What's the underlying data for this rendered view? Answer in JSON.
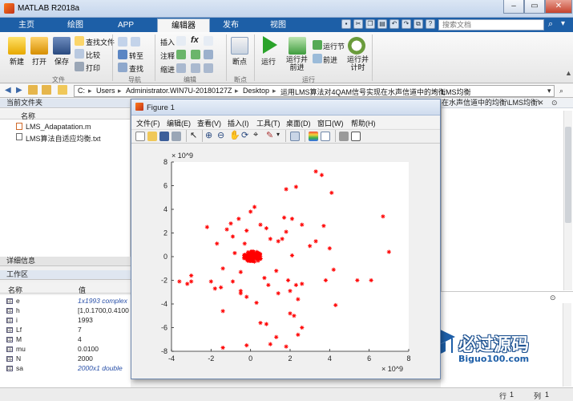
{
  "window": {
    "title": "MATLAB R2018a"
  },
  "ribbon_tabs": [
    "主页",
    "绘图",
    "APP",
    "编辑器",
    "发布",
    "视图"
  ],
  "help_search_placeholder": "搜索文档",
  "ribbon": {
    "file_group": {
      "new": "新建",
      "open": "打开",
      "save": "保存",
      "find_files": "查找文件",
      "compare": "比较",
      "print": "打印",
      "label": "文件"
    },
    "nav_group": {
      "goto": "转至",
      "find": "查找",
      "label": "导航"
    },
    "edit_group": {
      "insert": "插入",
      "comment": "注释",
      "indent": "缩进",
      "label": "编辑"
    },
    "breakpoint_group": {
      "breakpoints": "断点",
      "label": "断点"
    },
    "run_group": {
      "run": "运行",
      "run_advance": "运行并\n前进",
      "run_section": "运行节",
      "advance": "前进",
      "run_time": "运行并\n计时",
      "label": "运行"
    }
  },
  "address": {
    "crumbs": [
      "C:",
      "Users",
      "Administrator.WIN7U-20180127Z",
      "Desktop",
      "运用LMS算法对4QAM信号实现在水声信道中的均衡",
      "LMS均衡"
    ],
    "right_tail": "在水声信道中的均衡\\LMS均衡\\"
  },
  "file_browser": {
    "title": "当前文件夹",
    "column": "名称",
    "files": [
      "LMS_Adapatation.m",
      "LMS算法自适应均衡.txt"
    ]
  },
  "details_title": "详细信息",
  "workspace": {
    "title": "工作区",
    "col_name": "名称",
    "col_value": "值",
    "rows": [
      {
        "name": "e",
        "value": "1x1993 complex"
      },
      {
        "name": "h",
        "value": "[1,0.1700,0.4100"
      },
      {
        "name": "i",
        "value": "1993"
      },
      {
        "name": "Lf",
        "value": "7"
      },
      {
        "name": "M",
        "value": "4"
      },
      {
        "name": "mu",
        "value": "0.0100"
      },
      {
        "name": "N",
        "value": "2000"
      },
      {
        "name": "sa",
        "value": "2000x1 double"
      }
    ]
  },
  "figure": {
    "title": "Figure 1",
    "menus": [
      "文件(F)",
      "编辑(E)",
      "查看(V)",
      "插入(I)",
      "工具(T)",
      "桌面(D)",
      "窗口(W)",
      "帮助(H)"
    ]
  },
  "chart_data": {
    "type": "scatter",
    "title": "",
    "xlabel": "",
    "ylabel": "",
    "x_exponent": "× 10^9",
    "y_exponent": "× 10^9",
    "xlim": [
      -4,
      8
    ],
    "ylim": [
      -8,
      8
    ],
    "xticks": [
      -4,
      -2,
      0,
      2,
      4,
      6,
      8
    ],
    "yticks": [
      -8,
      -6,
      -4,
      -2,
      0,
      2,
      4,
      6,
      8
    ],
    "marker": "*",
    "color": "#ff0000",
    "series": [
      {
        "points": [
          [
            3.3,
            7.2
          ],
          [
            2.3,
            5.9
          ],
          [
            1.8,
            5.7
          ],
          [
            4.1,
            5.4
          ],
          [
            3.6,
            6.9
          ],
          [
            0.2,
            4.2
          ],
          [
            0.0,
            3.8
          ],
          [
            -0.6,
            3.2
          ],
          [
            -1.0,
            2.8
          ],
          [
            0.5,
            2.7
          ],
          [
            1.7,
            3.3
          ],
          [
            2.1,
            3.2
          ],
          [
            6.7,
            3.4
          ],
          [
            -2.2,
            2.5
          ],
          [
            -1.2,
            2.3
          ],
          [
            -0.2,
            2.2
          ],
          [
            0.8,
            2.4
          ],
          [
            1.8,
            2.1
          ],
          [
            2.6,
            2.7
          ],
          [
            3.7,
            2.6
          ],
          [
            -0.9,
            1.7
          ],
          [
            1.0,
            1.5
          ],
          [
            1.4,
            1.3
          ],
          [
            3.3,
            1.3
          ],
          [
            -1.7,
            1.1
          ],
          [
            -0.3,
            1.1
          ],
          [
            1.6,
            1.5
          ],
          [
            3.0,
            0.9
          ],
          [
            4.0,
            0.7
          ],
          [
            -0.8,
            0.3
          ],
          [
            7.0,
            0.4
          ],
          [
            2.1,
            0.1
          ],
          [
            4.2,
            -1.1
          ],
          [
            3.8,
            -2.0
          ],
          [
            -1.4,
            -1.0
          ],
          [
            -0.5,
            -1.3
          ],
          [
            1.3,
            -1.2
          ],
          [
            -3.0,
            -1.6
          ],
          [
            -3.6,
            -2.1
          ],
          [
            -3.0,
            -2.1
          ],
          [
            -3.2,
            -2.3
          ],
          [
            -2.0,
            -2.1
          ],
          [
            -0.9,
            -2.1
          ],
          [
            0.7,
            -1.8
          ],
          [
            1.9,
            -2.0
          ],
          [
            2.3,
            -2.4
          ],
          [
            2.0,
            -2.9
          ],
          [
            -1.5,
            -2.6
          ],
          [
            -0.5,
            -2.9
          ],
          [
            0.9,
            -2.4
          ],
          [
            2.6,
            -2.3
          ],
          [
            5.4,
            -2.0
          ],
          [
            6.1,
            -2.0
          ],
          [
            -0.2,
            -3.4
          ],
          [
            1.4,
            -3.1
          ],
          [
            2.4,
            -3.6
          ],
          [
            0.3,
            -3.9
          ],
          [
            4.3,
            -4.1
          ],
          [
            -1.4,
            -4.6
          ],
          [
            2.0,
            -4.8
          ],
          [
            2.2,
            -5.0
          ],
          [
            0.5,
            -5.6
          ],
          [
            0.8,
            -5.7
          ],
          [
            2.6,
            -6.0
          ],
          [
            2.4,
            -6.6
          ],
          [
            1.3,
            -6.8
          ],
          [
            -0.2,
            -7.5
          ],
          [
            1.0,
            -7.4
          ],
          [
            1.8,
            -7.6
          ],
          [
            -1.4,
            -7.7
          ],
          [
            -0.5,
            -3.1
          ],
          [
            -1.8,
            -2.7
          ]
        ],
        "cluster": {
          "center": [
            0.1,
            0.0
          ],
          "spread": [
            0.45,
            0.45
          ],
          "count": 90
        }
      }
    ]
  }
}
